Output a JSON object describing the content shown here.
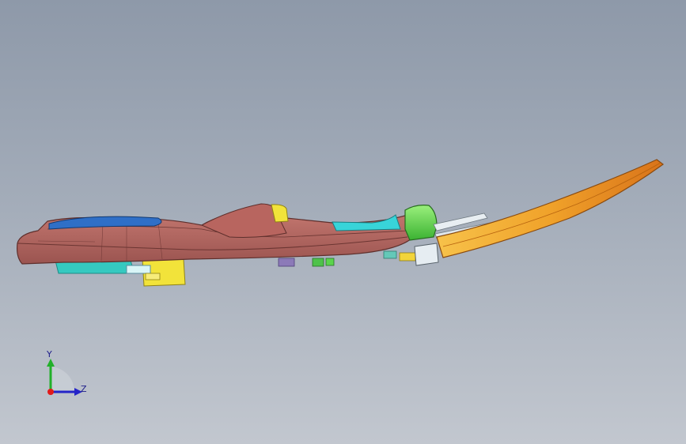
{
  "viewport": {
    "background_top": "#8e99a9",
    "background_bottom": "#c2c7cf"
  },
  "model": {
    "part_colors": {
      "main_body": "#c0706a",
      "main_body_shade": "#8f4c49",
      "cockpit_blue": "#2f6fc7",
      "seat_cyan": "#38d4d9",
      "underside_cyan": "#35c9c0",
      "bracket_yellow": "#f2e33a",
      "block_green": "#5fd84a",
      "rail_white": "#e8eef2",
      "blade_orange": "#ef9a1f"
    }
  },
  "triad": {
    "vertical_axis": "Y",
    "horizontal_axis": "Z",
    "icon": "coordinate-triad-icon"
  }
}
